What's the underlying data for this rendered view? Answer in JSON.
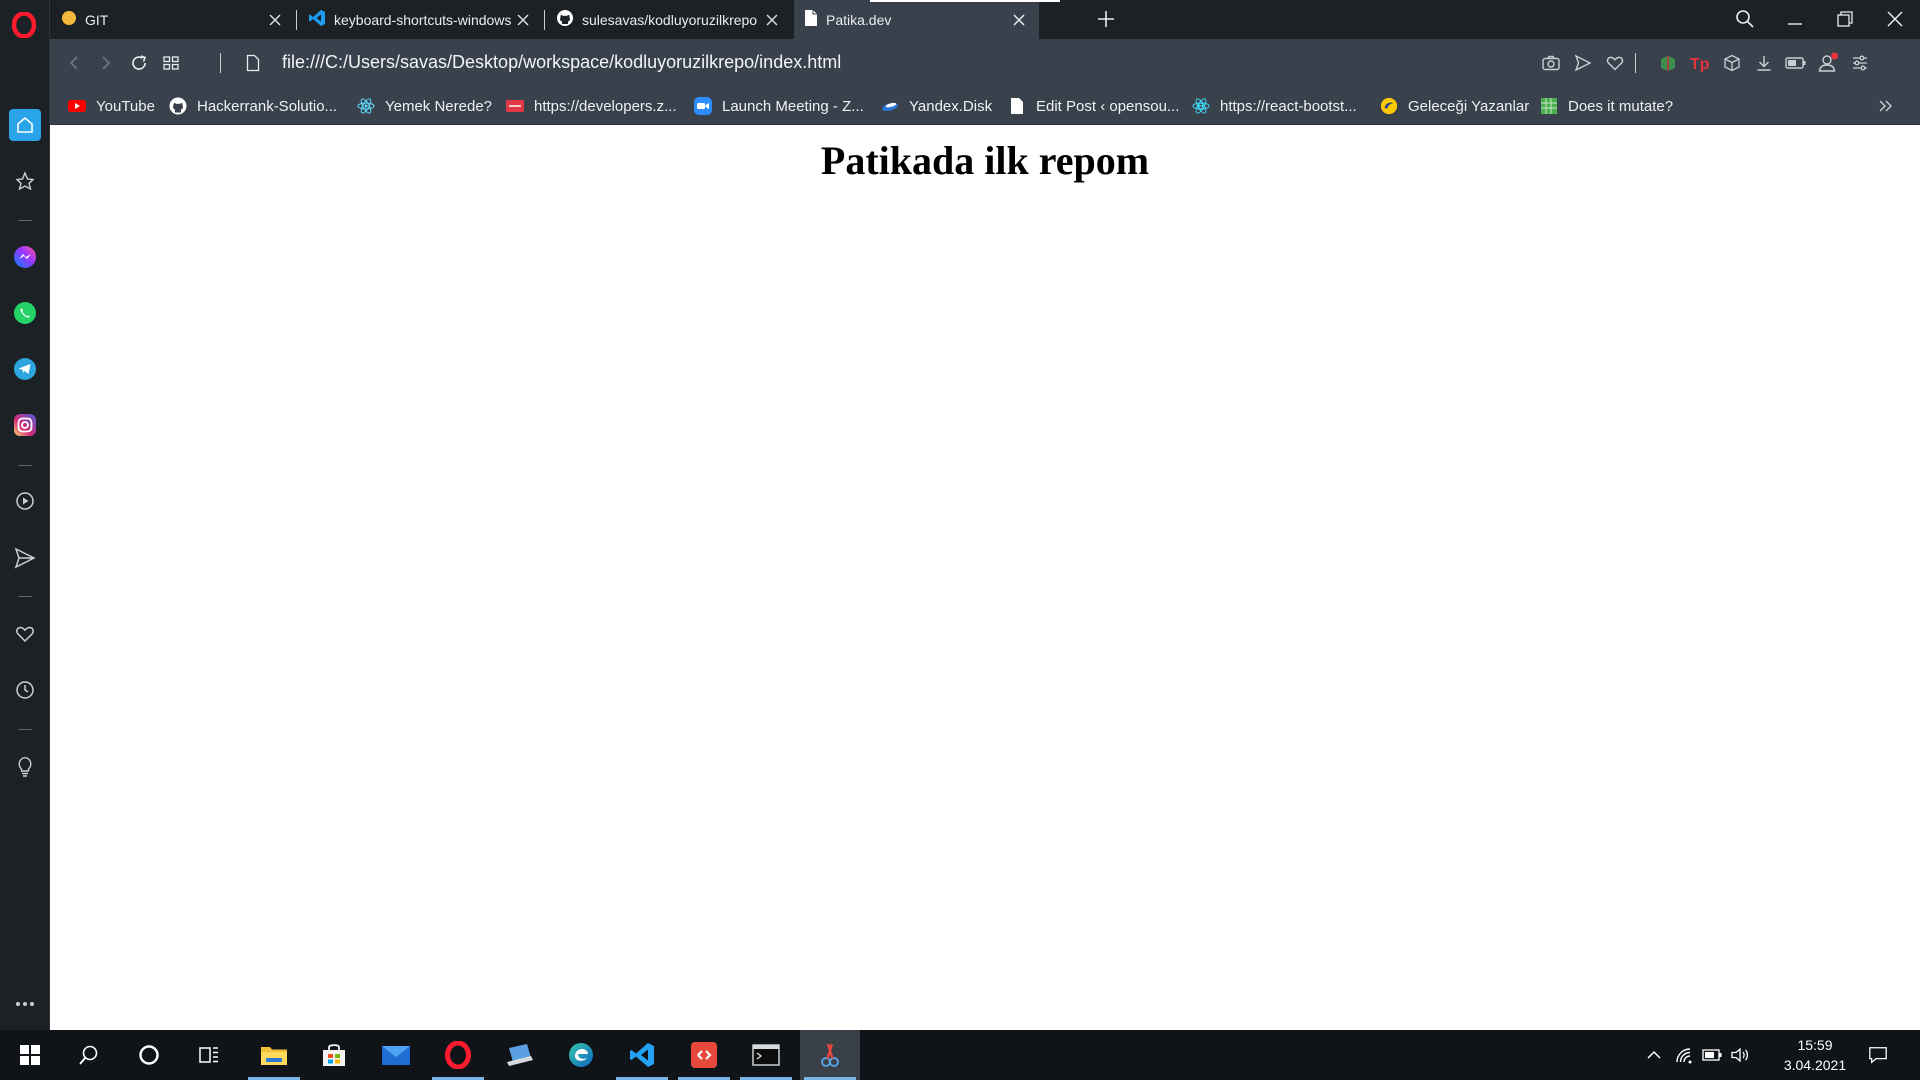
{
  "browser": {
    "tabs": [
      {
        "title": "GIT",
        "icon": "yellow-dot-icon",
        "active": false
      },
      {
        "title": "keyboard-shortcuts-windows",
        "icon": "vscode-icon",
        "active": false
      },
      {
        "title": "sulesavas/kodluyoruzilkrepo",
        "icon": "github-icon",
        "active": false
      },
      {
        "title": "Patika.dev",
        "icon": "file-icon",
        "active": true
      }
    ],
    "address": {
      "url": "file:///C:/Users/savas/Desktop/workspace/kodluyoruzilkrepo/index.html"
    },
    "bookmarks": [
      {
        "label": "YouTube",
        "icon": "youtube-icon",
        "color": "#ff0000"
      },
      {
        "label": "Hackerrank-Solutio...",
        "icon": "github-icon",
        "color": "#ffffff"
      },
      {
        "label": "Yemek Nerede?",
        "icon": "react-icon",
        "color": "#61dafb"
      },
      {
        "label": "https://developers.z...",
        "icon": "zomato-icon",
        "color": "#e23744"
      },
      {
        "label": "Launch Meeting - Z...",
        "icon": "zoom-icon",
        "color": "#2d8cff"
      },
      {
        "label": "Yandex.Disk",
        "icon": "yandex-disk-icon",
        "color": "#2b74d8"
      },
      {
        "label": "Edit Post ‹ opensou...",
        "icon": "document-icon",
        "color": "#ffffff"
      },
      {
        "label": "https://react-bootst...",
        "icon": "react-bootstrap-icon",
        "color": "#41e0fd"
      },
      {
        "label": "Geleceği Yazanlar",
        "icon": "turkcell-icon",
        "color": "#ffc900"
      },
      {
        "label": "Does it mutate?",
        "icon": "grid-icon",
        "color": "#4caf50"
      }
    ]
  },
  "page": {
    "heading": "Patikada ilk repom"
  },
  "taskbar": {
    "time": "15:59",
    "date": "3.04.2021"
  }
}
